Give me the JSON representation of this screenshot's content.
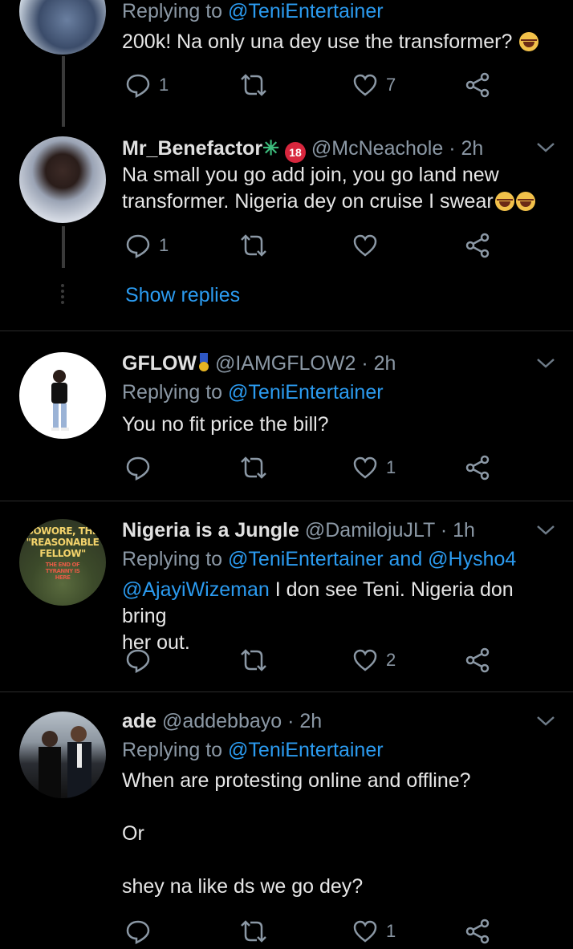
{
  "tweets": [
    {
      "reply_prefix": "Replying to ",
      "reply_to": "@TeniEntertainer",
      "text": [
        "200k! Na only una dey use the transformer?"
      ],
      "emoji": "laughing-tears",
      "replies": "1",
      "retweets": "",
      "likes": "7"
    },
    {
      "name": "Mr_Benefactor",
      "name_suffix": "✳",
      "badge": "18",
      "handle": "@McNeachole",
      "time": "2h",
      "text_line1": "Na small you go add join, you go land new",
      "text_line2": "transformer. Nigeria dey on cruise I swear",
      "replies": "1",
      "retweets": "",
      "likes": ""
    },
    {
      "name": "GFLOW",
      "handle": "@IAMGFLOW2",
      "time": "2h",
      "reply_prefix": "Replying to ",
      "reply_to": "@TeniEntertainer",
      "text": "You no fit price the bill?",
      "replies": "",
      "retweets": "",
      "likes": "1"
    },
    {
      "name": "Nigeria is a Jungle",
      "handle": "@DamilojuJLT",
      "time": "1h",
      "reply_prefix": "Replying to ",
      "reply_to": "@TeniEntertainer",
      "reply_and": " and ",
      "reply_to2": "@Hysho4",
      "mention": "@AjayiWizeman",
      "text_line1_rest": " I don see Teni. Nigeria don bring",
      "text_line2": "her out.",
      "avatar_text1": "SOWORE, THE",
      "avatar_text2": "\"REASONABLE",
      "avatar_text3": "FELLOW\"",
      "avatar_text4": "THE END OF",
      "avatar_text5": "TYRANNY IS",
      "avatar_text6": "HERE",
      "replies": "",
      "retweets": "",
      "likes": "2"
    },
    {
      "name": "ade",
      "handle": "@addebbayo",
      "time": "2h",
      "reply_prefix": "Replying to ",
      "reply_to": "@TeniEntertainer",
      "text1": "When are protesting online and offline?",
      "text2": "Or",
      "text3": "shey na like ds we go dey?",
      "replies": "",
      "retweets": "",
      "likes": "1"
    }
  ],
  "thread": {
    "show_replies": "Show replies"
  },
  "meta": {
    "dot": " · "
  },
  "colors": {
    "background": "#000000",
    "link": "#2b9bf0",
    "muted": "#8b98a5",
    "text": "#e6e6e6"
  },
  "icons": [
    "reply-icon",
    "retweet-icon",
    "like-icon",
    "share-icon",
    "chevron-down-icon",
    "thread-line"
  ]
}
